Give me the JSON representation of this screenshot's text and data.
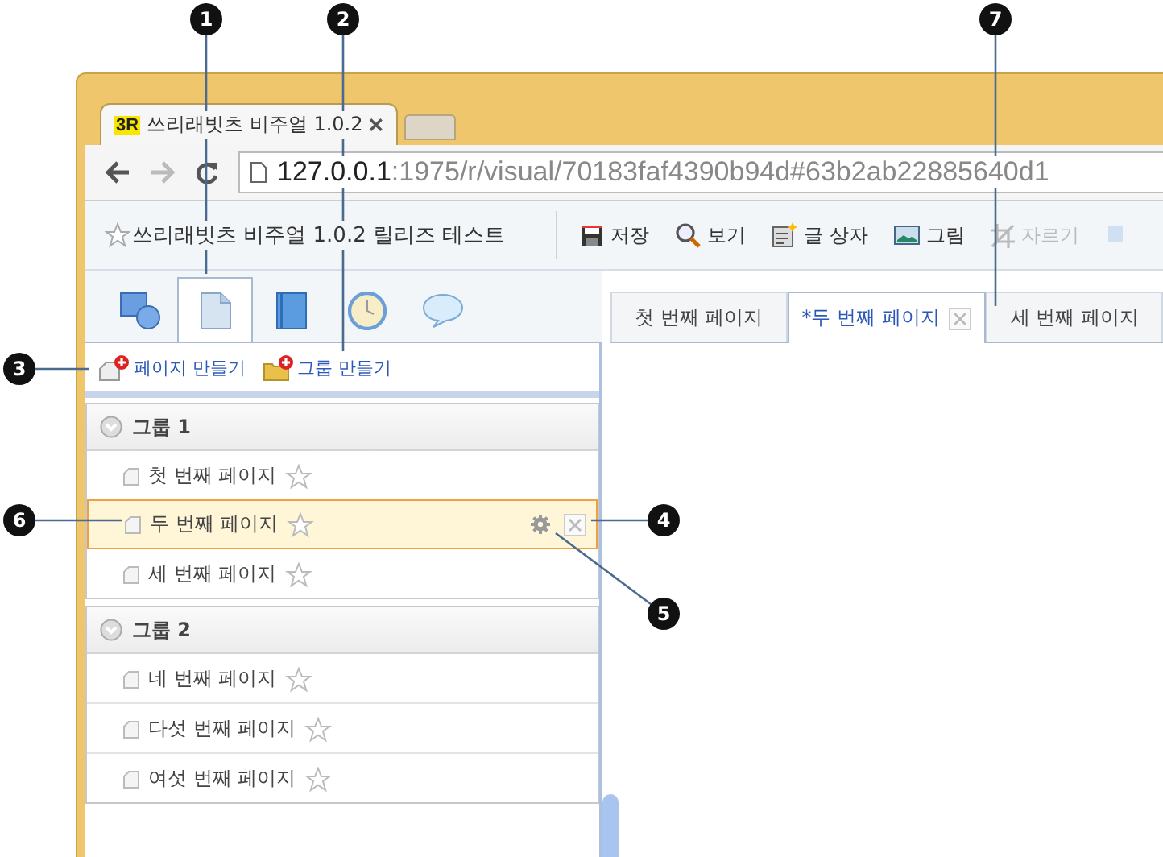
{
  "browser_tab": {
    "logo": "3R",
    "title": "쓰리래빗츠 비주얼 1.0.2"
  },
  "address": {
    "host": "127.0.0.1",
    "path": ":1975/r/visual/70183faf4390b94d#63b2ab22885640d1"
  },
  "document_title": "쓰리래빗츠 비주얼 1.0.2 릴리즈 테스트",
  "toolbar": [
    {
      "kind": "save",
      "label": "저장",
      "disabled": false
    },
    {
      "kind": "view",
      "label": "보기",
      "disabled": false
    },
    {
      "kind": "textbox",
      "label": "글 상자",
      "disabled": false
    },
    {
      "kind": "picture",
      "label": "그림",
      "disabled": false
    },
    {
      "kind": "crop",
      "label": "자르기",
      "disabled": true
    }
  ],
  "panel_tabs": [
    {
      "kind": "shapes",
      "selected": false
    },
    {
      "kind": "page",
      "selected": true
    },
    {
      "kind": "book",
      "selected": false
    },
    {
      "kind": "clock",
      "selected": false
    },
    {
      "kind": "comment",
      "selected": false
    }
  ],
  "actions": [
    {
      "kind": "page",
      "label": "페이지 만들기"
    },
    {
      "kind": "group",
      "label": "그룹 만들기"
    }
  ],
  "groups": [
    {
      "name": "그룹 1",
      "expanded": true,
      "pages": [
        {
          "name": "첫 번째 페이지",
          "selected": false
        },
        {
          "name": "두 번째 페이지",
          "selected": true
        },
        {
          "name": "세 번째 페이지",
          "selected": false
        }
      ]
    },
    {
      "name": "그룹 2",
      "expanded": true,
      "pages": [
        {
          "name": "네 번째 페이지",
          "selected": false
        },
        {
          "name": "다섯 번째 페이지",
          "selected": false
        },
        {
          "name": "여섯 번째 페이지",
          "selected": false
        }
      ]
    }
  ],
  "page_tabs": [
    {
      "label": "첫 번째 페이지",
      "selected": false
    },
    {
      "label": "*두 번째 페이지",
      "selected": true
    },
    {
      "label": "세 번째 페이지",
      "selected": false
    }
  ],
  "callouts": [
    {
      "number": "1"
    },
    {
      "number": "2"
    },
    {
      "number": "3"
    },
    {
      "number": "4"
    },
    {
      "number": "5"
    },
    {
      "number": "6"
    },
    {
      "number": "7"
    }
  ]
}
